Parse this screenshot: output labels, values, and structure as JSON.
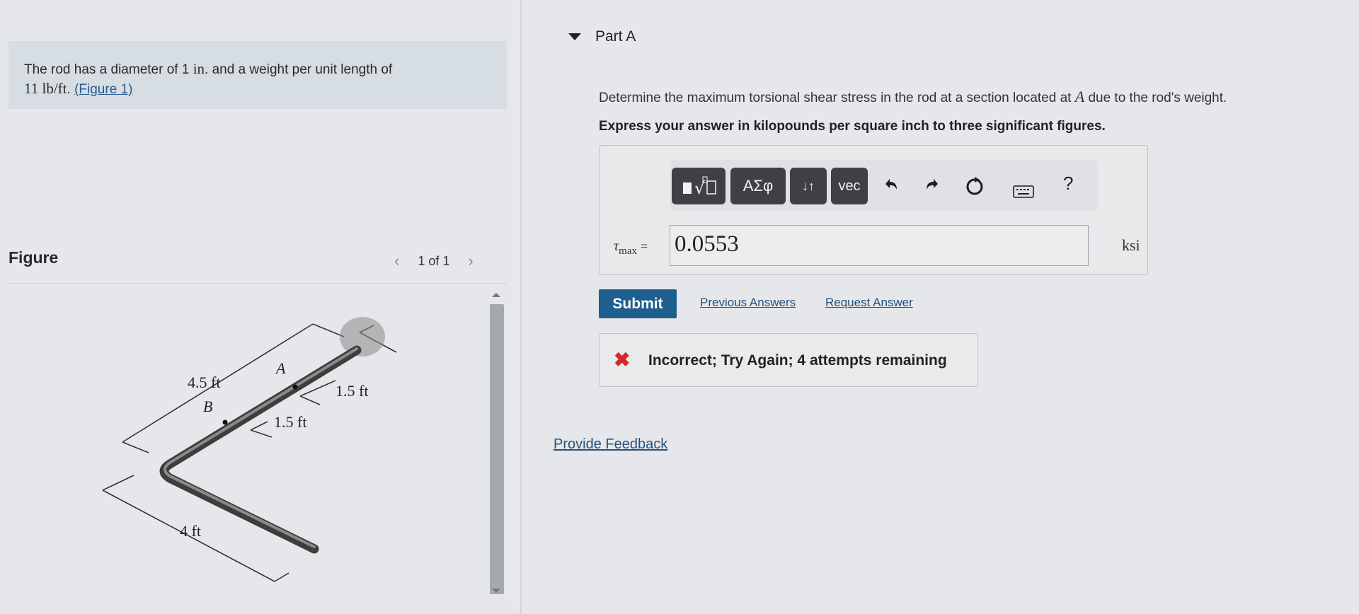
{
  "problem": {
    "text_before": "The rod has a diameter of 1",
    "diameter_unit": "in",
    "text_mid": ". and a weight per unit length of",
    "weight_value": "11",
    "weight_unit": "lb/ft",
    "figure_link": "(Figure 1)"
  },
  "figure": {
    "heading": "Figure",
    "pager_text": "1 of 1",
    "labels": {
      "dim_a": "4.5 ft",
      "point_a": "A",
      "point_b": "B",
      "dim_b": "1.5 ft",
      "dim_c": "1.5 ft",
      "dim_d": "4 ft"
    }
  },
  "part": {
    "title": "Part A",
    "question_before": "Determine the maximum torsional shear stress in the rod at a section located at",
    "question_point": "A",
    "question_after": "due to the rod's weight.",
    "instruction": "Express your answer in kilopounds per square inch to three significant figures."
  },
  "toolbar": {
    "items": [
      "templates-icon",
      "greek-symbols",
      "arrows-icon",
      "vec",
      "undo-icon",
      "redo-icon",
      "reset-icon",
      "keyboard-icon",
      "help-icon"
    ],
    "greek_label": "ΑΣφ",
    "vec_label": "vec",
    "arrows_label": "↓↑",
    "help_label": "?"
  },
  "answer": {
    "variable": "τ",
    "subscript": "max",
    "equals": "=",
    "value": "0.0553",
    "unit": "ksi"
  },
  "actions": {
    "submit_label": "Submit",
    "previous_answers": "Previous Answers",
    "request_answer": "Request Answer"
  },
  "feedback": {
    "status": "incorrect",
    "message": "Incorrect; Try Again; 4 attempts remaining",
    "color": "#d22a2a"
  },
  "provide_feedback": "Provide Feedback"
}
